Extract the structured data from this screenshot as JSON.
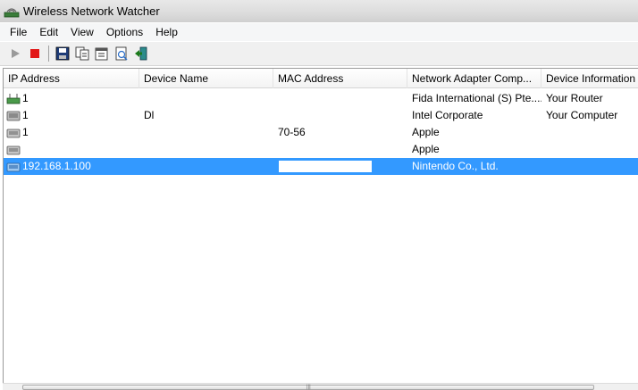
{
  "window": {
    "title": "Wireless Network Watcher"
  },
  "menu": [
    "File",
    "Edit",
    "View",
    "Options",
    "Help"
  ],
  "toolbar": {
    "buttons": [
      "play-icon",
      "stop-icon",
      "save-icon",
      "copy-icon",
      "properties-icon",
      "html-report-icon",
      "exit-icon"
    ]
  },
  "columns": [
    "IP Address",
    "Device Name",
    "MAC Address",
    "Network Adapter Comp...",
    "Device Information"
  ],
  "rows": [
    {
      "ip": "1",
      "device": "",
      "mac": "",
      "adapter": "Fida International (S) Pte....",
      "info": "Your Router"
    },
    {
      "ip": "1",
      "device": "Dl",
      "mac": "",
      "adapter": "Intel Corporate",
      "info": "Your Computer"
    },
    {
      "ip": "1",
      "device": "",
      "mac": "70-56",
      "adapter": "Apple",
      "info": ""
    },
    {
      "ip": "",
      "device": "",
      "mac": "",
      "adapter": "Apple",
      "info": ""
    },
    {
      "ip": "192.168.1.100",
      "device": "",
      "mac": "",
      "adapter": "Nintendo Co., Ltd.",
      "info": ""
    }
  ],
  "colors": {
    "selection": "#3399ff",
    "titlebar": "#dcdcdc"
  }
}
